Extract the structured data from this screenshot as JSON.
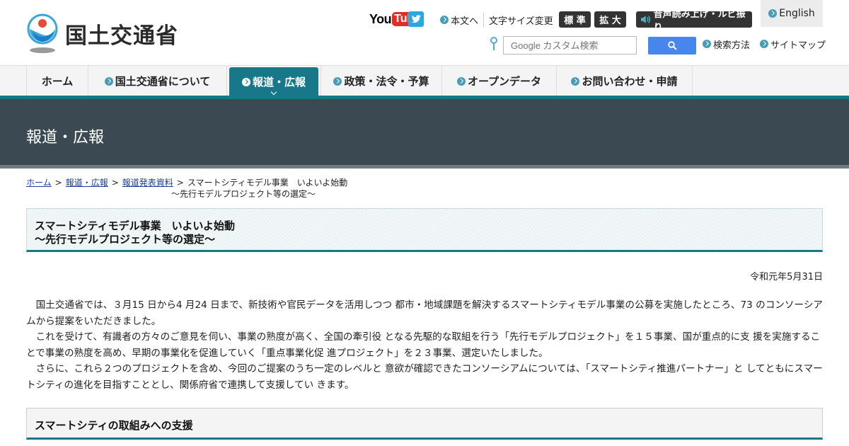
{
  "site": {
    "logo_text": "国土交通省"
  },
  "header": {
    "youtube": {
      "you": "You",
      "tube": "Tube"
    },
    "honbun": "本文へ",
    "text_size_label": "文字サイズ変更",
    "size_standard": "標 準",
    "size_large": "拡 大",
    "voice_ruby": "音声読み上げ・ルビ振り",
    "english": "English",
    "search_placeholder": "Google カスタム検索",
    "search_method": "検索方法",
    "sitemap": "サイトマップ"
  },
  "nav": {
    "items": [
      {
        "label": "ホーム",
        "bullet": false,
        "active": false
      },
      {
        "label": "国土交通省について",
        "bullet": true,
        "active": false
      },
      {
        "label": "報道・広報",
        "bullet": true,
        "active": true
      },
      {
        "label": "政策・法令・予算",
        "bullet": true,
        "active": false
      },
      {
        "label": "オープンデータ",
        "bullet": true,
        "active": false
      },
      {
        "label": "お問い合わせ・申請",
        "bullet": true,
        "active": false
      }
    ]
  },
  "banner": {
    "title": "報道・広報"
  },
  "breadcrumb": {
    "home": "ホーム",
    "press": "報道・広報",
    "releases": "報道発表資料",
    "sep": ">",
    "current_line1": "スマートシティモデル事業　いよいよ始動",
    "current_line2": "～先行モデルプロジェクト等の選定～"
  },
  "article": {
    "title_line1": "スマートシティモデル事業　いよいよ始動",
    "title_line2": "～先行モデルプロジェクト等の選定～",
    "date": "令和元年5月31日",
    "paragraphs": [
      "国土交通省では、３月15 日から4 月24 日まで、新技術や官民データを活用しつつ 都市・地域課題を解決するスマートシティモデル事業の公募を実施したところ、73 のコンソーシアムから提案をいただきました。",
      "これを受けて、有識者の方々のご意見を伺い、事業の熟度が高く、全国の牽引役 となる先駆的な取組を行う「先行モデルプロジェクト」を１５事業、国が重点的に支 援を実施することで事業の熟度を高め、早期の事業化を促進していく「重点事業化促 進プロジェクト」を２３事業、選定いたしました。",
      "さらに、これら２つのプロジェクトを含め、今回のご提案のうち一定のレベルと 意欲が確認できたコンソーシアムについては、「スマートシティ推進パートナー」と してともにスマートシティの進化を目指すこととし、関係府省で連携して支援してい きます。"
    ],
    "section_title": "スマートシティの取組みへの支援"
  },
  "colors": {
    "accent": "#17788a",
    "banner": "#3b4a52",
    "link": "#1a3f9c",
    "search_button": "#4787ed",
    "youtube_red": "#e52d27",
    "twitter_blue": "#2aa9e0"
  }
}
